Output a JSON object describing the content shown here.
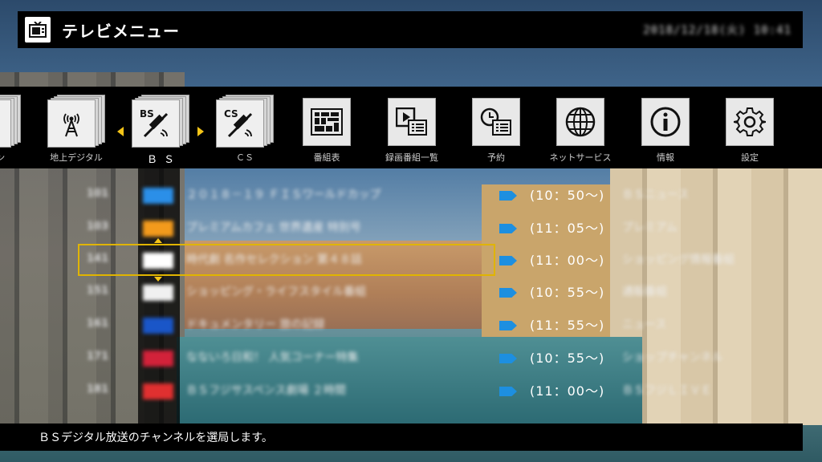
{
  "header": {
    "title": "テレビメニュー",
    "datetime": "2018/12/18(火) 10:41"
  },
  "menu": [
    {
      "label": "リーン",
      "icon": "partial-icon"
    },
    {
      "label": "地上デジタル",
      "icon": "terrestrial-antenna-icon"
    },
    {
      "label": "ＢＳ",
      "icon": "bs-satellite-icon",
      "active": true
    },
    {
      "label": "ＣＳ",
      "icon": "cs-satellite-icon"
    },
    {
      "label": "番組表",
      "icon": "program-guide-icon"
    },
    {
      "label": "録画番組一覧",
      "icon": "recorded-list-icon"
    },
    {
      "label": "予約",
      "icon": "reservation-icon"
    },
    {
      "label": "ネットサービス",
      "icon": "globe-icon"
    },
    {
      "label": "情報",
      "icon": "info-icon"
    },
    {
      "label": "設定",
      "icon": "gear-icon"
    }
  ],
  "channels": [
    {
      "num": "101",
      "logo_color": "#2b8fe8",
      "program": "２０１８－１９ ＦＩＳワールドカップ",
      "time": "(10：50〜)",
      "next": "ＢＳニュース"
    },
    {
      "num": "103",
      "logo_color": "#f39a1c",
      "program": "プレミアムカフェ 世界遺産 特別号",
      "time": "(11：05〜)",
      "next": "プレミアム"
    },
    {
      "num": "141",
      "logo_color": "#ffffff",
      "program": "時代劇 名作セレクション 第４８話",
      "time": "(11：00〜)",
      "next": "ショッピング情報番組"
    },
    {
      "num": "151",
      "logo_color": "#f0f0f0",
      "program": "ショッピング・ライフスタイル番組",
      "time": "(10：55〜)",
      "next": "通販番組"
    },
    {
      "num": "161",
      "logo_color": "#1a56c8",
      "program": "ドキュメンタリー 旅の記録",
      "time": "(11：55〜)",
      "next": "ニュース"
    },
    {
      "num": "171",
      "logo_color": "#d2223a",
      "program": "なないろ日和！ 人気コーナー特集",
      "time": "(10：55〜)",
      "next": "ショップチャンネル"
    },
    {
      "num": "181",
      "logo_color": "#e03030",
      "program": "ＢＳフジサスペンス劇場 ２時間",
      "time": "(11：00〜)",
      "next": "ＢＳフジＬＩＶＥ"
    }
  ],
  "footer": {
    "message": "ＢＳデジタル放送のチャンネルを選局します。"
  }
}
